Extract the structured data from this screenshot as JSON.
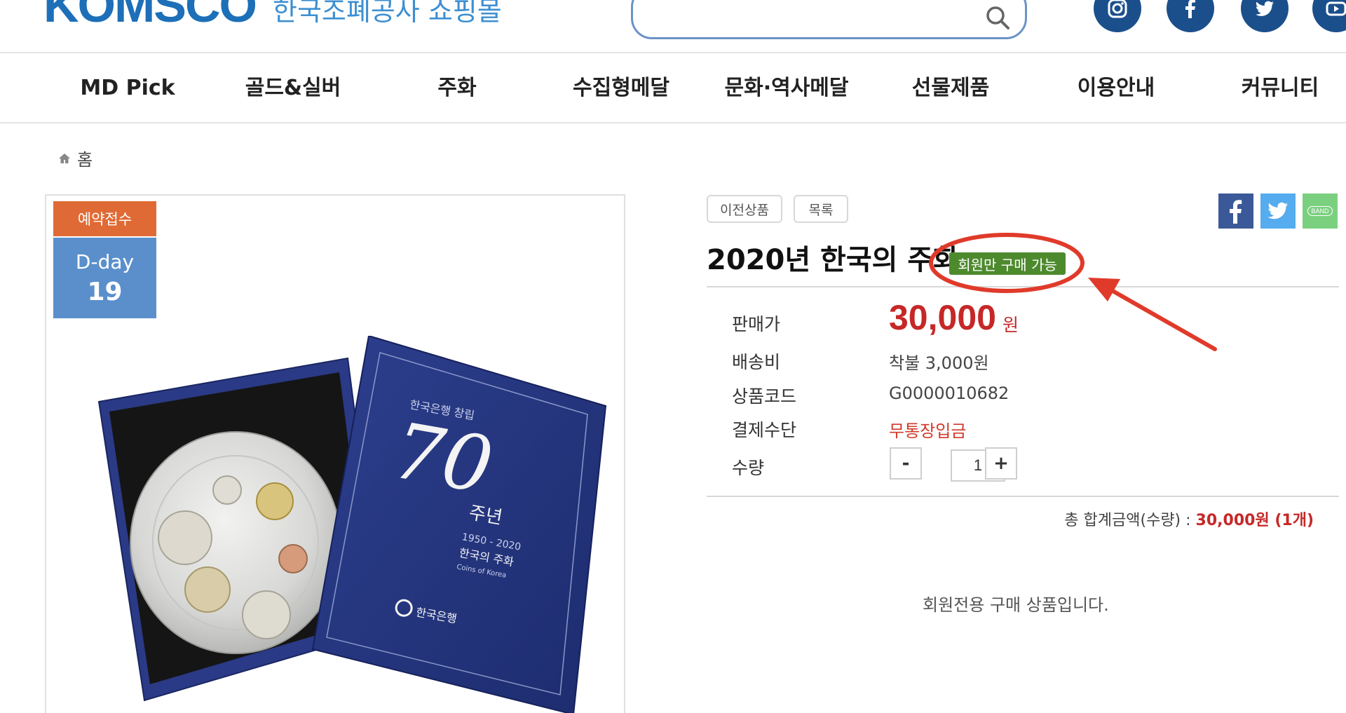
{
  "header": {
    "logo_text": "KOMSCO",
    "logo_subtitle": "한국조폐공사 쇼핑몰",
    "search_placeholder": ""
  },
  "nav": [
    {
      "label": "MD Pick"
    },
    {
      "label": "골드&실버"
    },
    {
      "label": "주화"
    },
    {
      "label": "수집형메달"
    },
    {
      "label": "문화·역사메달"
    },
    {
      "label": "선물제품"
    },
    {
      "label": "이용안내"
    },
    {
      "label": "커뮤니티"
    }
  ],
  "breadcrumb": {
    "home": "홈"
  },
  "badges": {
    "reserve": "예약접수",
    "dday_label": "D-day",
    "dday_value": "19"
  },
  "product": {
    "prev_button": "이전상품",
    "list_button": "목록",
    "title": "2020년 한국의 주화",
    "member_tag": "회원만 구매 가능",
    "price_label": "판매가",
    "price": "30,000",
    "price_unit": "원",
    "shipping_label": "배송비",
    "shipping_value": "착불 3,000원",
    "code_label": "상품코드",
    "code_value": "G0000010682",
    "payment_label": "결제수단",
    "payment_value": "무통장입금",
    "qty_label": "수량",
    "qty_minus": "-",
    "qty_value": "1",
    "qty_plus": "+",
    "total_label": "총 합계금액(수량) : ",
    "total_value": "30,000원 (1개)",
    "member_only_message": "회원전용 구매 상품입니다."
  },
  "share": {
    "band_label": "BAND"
  },
  "image": {
    "box_text_top": "한국은행 창립",
    "box_number": "70",
    "box_text_unit": "주년",
    "box_years": "1950 - 2020",
    "box_name": "한국의 주화",
    "box_en": "Coins of Korea",
    "box_bank": "한국은행"
  },
  "colors": {
    "brand": "#1d6fb8",
    "price_red": "#c62828",
    "member_tag": "#4d8a2e",
    "annotation_red": "#e03a2a",
    "dday_blue": "#5a8fcc",
    "reserve_orange": "#e06a35"
  }
}
